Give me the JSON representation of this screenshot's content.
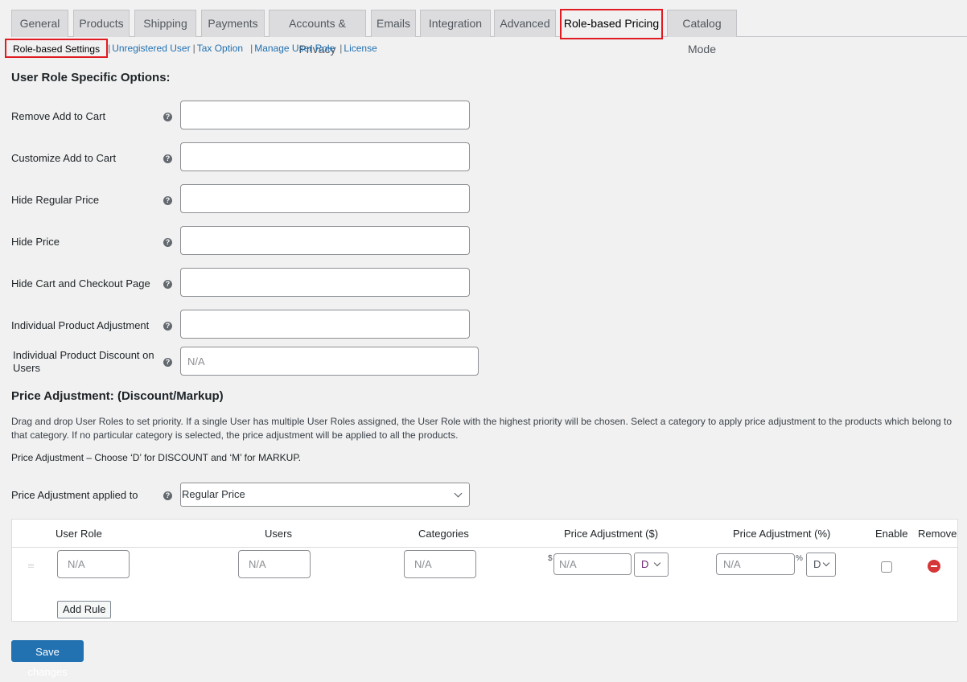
{
  "tabs": [
    {
      "label": "General",
      "active": false
    },
    {
      "label": "Products",
      "active": false
    },
    {
      "label": "Shipping",
      "active": false
    },
    {
      "label": "Payments",
      "active": false
    },
    {
      "label": "Accounts & Privacy",
      "active": false
    },
    {
      "label": "Emails",
      "active": false
    },
    {
      "label": "Integration",
      "active": false
    },
    {
      "label": "Advanced",
      "active": false
    },
    {
      "label": "Role-based Pricing",
      "active": true
    },
    {
      "label": "Catalog Mode",
      "active": false
    }
  ],
  "subnav": {
    "current": "Role-based Settings",
    "links": [
      "Unregistered User",
      "Tax Option",
      "Manage User Role",
      "License"
    ],
    "separator": "|"
  },
  "section1": {
    "title": "User Role Specific Options:",
    "fields": [
      {
        "label": "Remove Add to Cart",
        "value": "",
        "placeholder": ""
      },
      {
        "label": "Customize Add to Cart",
        "value": "",
        "placeholder": ""
      },
      {
        "label": "Hide Regular Price",
        "value": "",
        "placeholder": ""
      },
      {
        "label": "Hide Price",
        "value": "",
        "placeholder": ""
      },
      {
        "label": "Hide Cart and Checkout Page",
        "value": "",
        "placeholder": ""
      },
      {
        "label": "Individual Product Adjustment",
        "value": "",
        "placeholder": ""
      },
      {
        "label": "Individual Product Discount on Users",
        "value": "",
        "placeholder": "N/A"
      }
    ],
    "help_icon": "?"
  },
  "section2": {
    "title": "Price Adjustment: (Discount/Markup)",
    "description": "Drag and drop User Roles to set priority. If a single User has multiple User Roles assigned, the User Role with the highest priority will be chosen. Select a category to apply price adjustment to the products which belong to that category. If no particular category is selected, the price adjustment will be applied to all the products.",
    "note": "Price Adjustment – Choose ‘D’ for DISCOUNT and ‘M’ for MARKUP.",
    "applied_to_label": "Price Adjustment applied to",
    "applied_to_value": "Regular Price"
  },
  "rules_table": {
    "headers": [
      "User Role",
      "Users",
      "Categories",
      "Price Adjustment ($)",
      "Price Adjustment (%)",
      "Enable",
      "Remove"
    ],
    "rows": [
      {
        "user_role_placeholder": "N/A",
        "users_placeholder": "N/A",
        "categories_placeholder": "N/A",
        "price_fixed_placeholder": "N/A",
        "price_fixed_unit": "$",
        "price_fixed_type": "D",
        "price_percent_placeholder": "N/A",
        "price_percent_unit": "%",
        "price_percent_type": "D",
        "enabled": false
      }
    ],
    "add_rule_label": "Add Rule"
  },
  "save_label": "Save changes",
  "colors": {
    "accent": "#2271b1",
    "highlight_border": "#e11b22",
    "remove": "#d63638"
  }
}
